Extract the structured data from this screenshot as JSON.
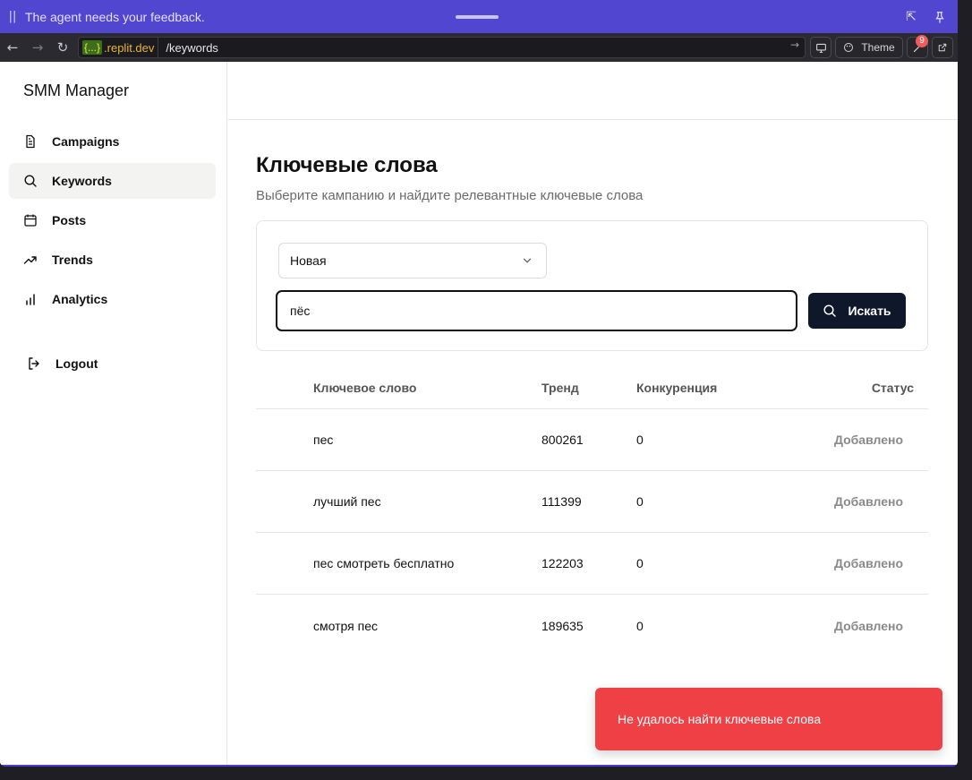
{
  "agent_bar": {
    "pause_icon": "pause-icon",
    "message": "The agent needs your feedback."
  },
  "browser": {
    "url_braces": "{...}",
    "url_domain": ".replit.dev",
    "url_path": "/keywords",
    "theme_label": "Theme",
    "notifications_count": "9"
  },
  "sidebar": {
    "brand": "SMM Manager",
    "items": [
      {
        "label": "Campaigns",
        "icon": "document-icon"
      },
      {
        "label": "Keywords",
        "icon": "search-icon"
      },
      {
        "label": "Posts",
        "icon": "calendar-icon"
      },
      {
        "label": "Trends",
        "icon": "trending-up-icon"
      },
      {
        "label": "Analytics",
        "icon": "bar-chart-icon"
      }
    ],
    "logout": "Logout"
  },
  "main": {
    "title": "Ключевые слова",
    "subtitle": "Выберите кампанию и найдите релевантные ключевые слова",
    "campaign_select": "Новая",
    "search_value": "пёс",
    "search_button": "Искать"
  },
  "table": {
    "headers": {
      "keyword": "Ключевое слово",
      "trend": "Тренд",
      "competition": "Конкуренция",
      "status": "Статус"
    },
    "rows": [
      {
        "keyword": "пес",
        "trend": "800261",
        "competition": "0",
        "status": "Добавлено"
      },
      {
        "keyword": "лучший пес",
        "trend": "111399",
        "competition": "0",
        "status": "Добавлено"
      },
      {
        "keyword": "пес смотреть бесплатно",
        "trend": "122203",
        "competition": "0",
        "status": "Добавлено"
      },
      {
        "keyword": "смотря пес",
        "trend": "189635",
        "competition": "0",
        "status": "Добавлено"
      }
    ]
  },
  "toast": {
    "message": "Не удалось найти ключевые слова",
    "color": "#ef4045"
  }
}
